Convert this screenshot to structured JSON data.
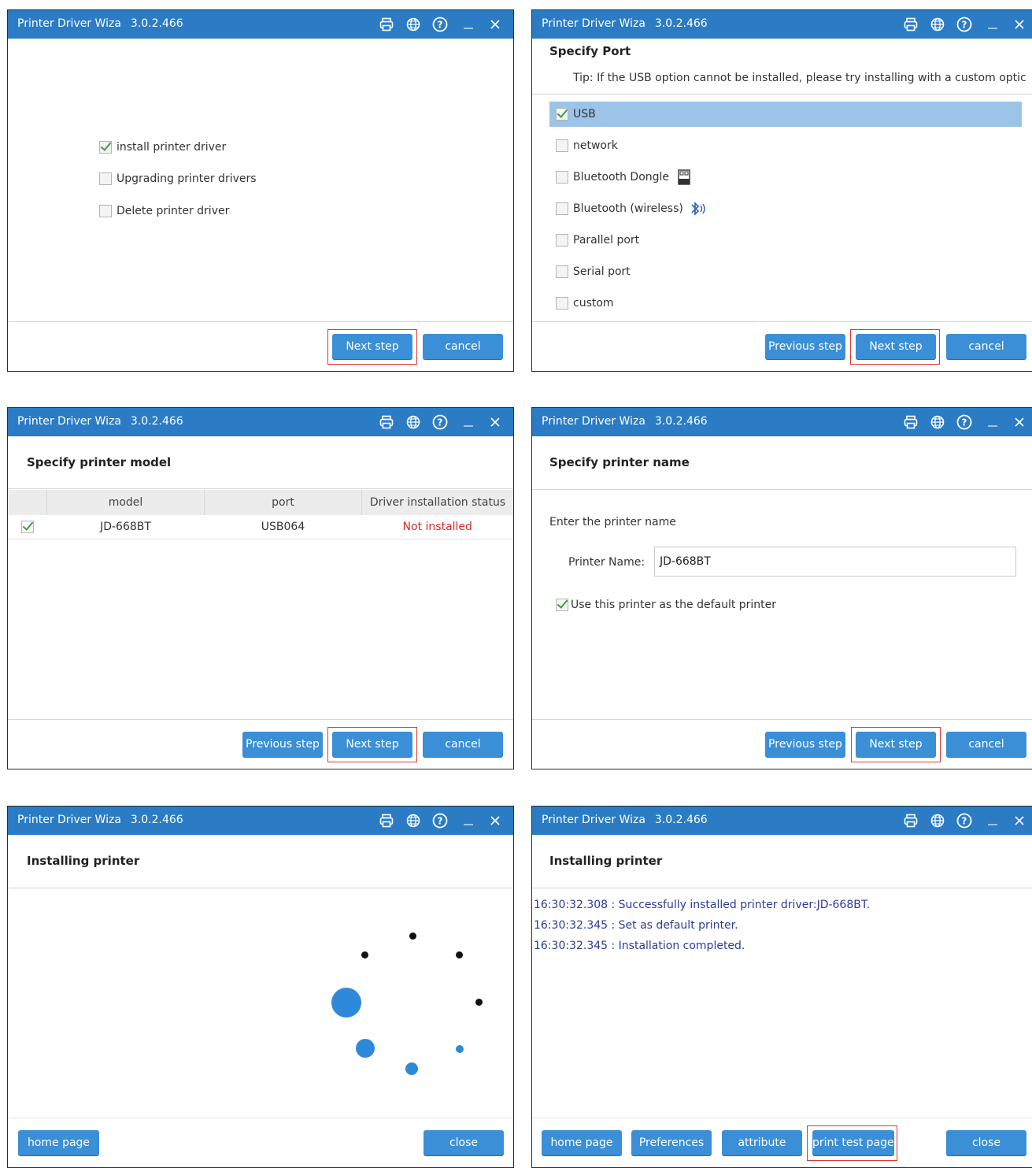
{
  "app": {
    "title": "Printer Driver Wiza",
    "version": "3.0.2.466",
    "icons": [
      "printer-icon",
      "globe-icon",
      "help-icon",
      "minimize-icon",
      "close-icon"
    ]
  },
  "buttons": {
    "next": "Next step",
    "cancel": "cancel",
    "previous": "Previous step",
    "home": "home page",
    "close": "close",
    "preferences": "Preferences",
    "attribute": "attribute",
    "print_test": "print test page"
  },
  "step1": {
    "options": [
      {
        "label": "install printer driver",
        "checked": true
      },
      {
        "label": "Upgrading printer drivers",
        "checked": false
      },
      {
        "label": "Delete printer driver",
        "checked": false
      }
    ]
  },
  "step2": {
    "title": "Specify Port",
    "tip": "Tip: If the USB option cannot be installed, please try installing with a custom optic",
    "ports": [
      {
        "label": "USB",
        "checked": true,
        "selected": true,
        "icon": ""
      },
      {
        "label": "network",
        "checked": false,
        "selected": false,
        "icon": ""
      },
      {
        "label": "Bluetooth Dongle",
        "checked": false,
        "selected": false,
        "icon": "bluetooth-dongle-icon"
      },
      {
        "label": "Bluetooth (wireless)",
        "checked": false,
        "selected": false,
        "icon": "bluetooth-icon"
      },
      {
        "label": "Parallel port",
        "checked": false,
        "selected": false,
        "icon": ""
      },
      {
        "label": "Serial port",
        "checked": false,
        "selected": false,
        "icon": ""
      },
      {
        "label": "custom",
        "checked": false,
        "selected": false,
        "icon": ""
      }
    ]
  },
  "step3": {
    "title": "Specify printer model",
    "columns": [
      "model",
      "port",
      "Driver installation status"
    ],
    "rows": [
      {
        "checked": true,
        "model": "JD-668BT",
        "port": "USB064",
        "status": "Not installed"
      }
    ],
    "status_color": "#d42a2a"
  },
  "step4": {
    "title": "Specify printer name",
    "prompt": "Enter the printer name",
    "name_label": "Printer Name:",
    "name_value": "JD-668BT",
    "default_label": "Use this printer as the default printer",
    "default_checked": true
  },
  "step5": {
    "title": "Installing printer"
  },
  "step6": {
    "title": "Installing printer",
    "log": [
      "16:30:32.308 : Successfully installed printer driver:JD-668BT.",
      "16:30:32.345 : Set as default printer.",
      "16:30:32.345 : Installation completed."
    ]
  },
  "colors": {
    "titlebar": "#2b7cc4",
    "button": "#3a8fd6",
    "highlight": "#e0392b",
    "selection": "#9cc3e8",
    "log_text": "#2a3b9a"
  }
}
